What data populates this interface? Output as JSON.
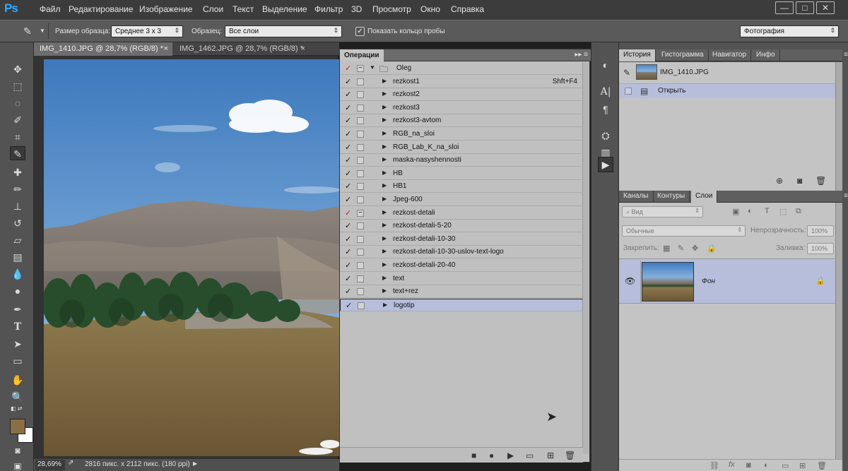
{
  "menubar": {
    "logo": "Ps",
    "items": [
      "Файл",
      "Редактирование",
      "Изображение",
      "Слои",
      "Текст",
      "Выделение",
      "Фильтр",
      "3D",
      "Просмотр",
      "Окно",
      "Справка"
    ],
    "window_buttons": [
      "—",
      "□",
      "✕"
    ]
  },
  "options": {
    "sample_size_label": "Размер образца:",
    "sample_size_value": "Среднее 3 х 3",
    "sample_label": "Образец:",
    "sample_value": "Все слои",
    "show_ring_label": "Показать кольцо пробы",
    "show_ring_checked": true,
    "workspace_value": "Фотография"
  },
  "tabs": [
    {
      "label": "IMG_1410.JPG @ 28,7% (RGB/8) *",
      "close": "×",
      "active": true
    },
    {
      "label": "IMG_1462.JPG @ 28,7% (RGB/8) *",
      "close": "×",
      "active": false
    }
  ],
  "status": {
    "zoom": "28,69%",
    "info": "2816 пикс. x 2112 пикс. (180 ppi)"
  },
  "actions": {
    "title": "Операции",
    "header_icons": "▸▸ ≡",
    "rows": [
      {
        "name": "Oleg",
        "check": "✓",
        "red": true,
        "box": "−",
        "set": true,
        "shortcut": "",
        "selected": false
      },
      {
        "name": "rezkost1",
        "check": "✓",
        "red": false,
        "box": "",
        "set": false,
        "shortcut": "Shft+F4",
        "selected": false
      },
      {
        "name": "rezkost2",
        "check": "✓",
        "red": false,
        "box": "",
        "set": false,
        "shortcut": "",
        "selected": false
      },
      {
        "name": "rezkost3",
        "check": "✓",
        "red": false,
        "box": "",
        "set": false,
        "shortcut": "",
        "selected": false
      },
      {
        "name": "rezkost3-avtom",
        "check": "✓",
        "red": false,
        "box": "",
        "set": false,
        "shortcut": "",
        "selected": false
      },
      {
        "name": "RGB_na_sloi",
        "check": "✓",
        "red": false,
        "box": "",
        "set": false,
        "shortcut": "",
        "selected": false
      },
      {
        "name": "RGB_Lab_K_na_sloi",
        "check": "✓",
        "red": false,
        "box": "",
        "set": false,
        "shortcut": "",
        "selected": false
      },
      {
        "name": "maska-nasyshennosti",
        "check": "✓",
        "red": false,
        "box": "",
        "set": false,
        "shortcut": "",
        "selected": false
      },
      {
        "name": "HB",
        "check": "✓",
        "red": false,
        "box": "",
        "set": false,
        "shortcut": "",
        "selected": false
      },
      {
        "name": "HB1",
        "check": "✓",
        "red": false,
        "box": "",
        "set": false,
        "shortcut": "",
        "selected": false
      },
      {
        "name": "Jpeg-600",
        "check": "✓",
        "red": false,
        "box": "",
        "set": false,
        "shortcut": "",
        "selected": false
      },
      {
        "name": "rezkost-detali",
        "check": "✓",
        "red": true,
        "box": "−",
        "set": false,
        "shortcut": "",
        "selected": false
      },
      {
        "name": "rezkost-detali-5-20",
        "check": "✓",
        "red": false,
        "box": "",
        "set": false,
        "shortcut": "",
        "selected": false
      },
      {
        "name": "rezkost-detali-10-30",
        "check": "✓",
        "red": false,
        "box": "",
        "set": false,
        "shortcut": "",
        "selected": false
      },
      {
        "name": "rezkost-detali-10-30-uslov-text-logo",
        "check": "✓",
        "red": false,
        "box": "",
        "set": false,
        "shortcut": "",
        "selected": false
      },
      {
        "name": "rezkost-detali-20-40",
        "check": "✓",
        "red": false,
        "box": "",
        "set": false,
        "shortcut": "",
        "selected": false
      },
      {
        "name": "text",
        "check": "✓",
        "red": false,
        "box": "",
        "set": false,
        "shortcut": "",
        "selected": false
      },
      {
        "name": "text+rez",
        "check": "✓",
        "red": false,
        "box": "",
        "set": false,
        "shortcut": "",
        "selected": false
      },
      {
        "name": "logotip",
        "check": "✓",
        "red": false,
        "box": "",
        "set": false,
        "shortcut": "",
        "selected": true
      }
    ],
    "footer_icons": [
      "■",
      "●",
      "▶",
      "▭",
      "⊞",
      "🗑"
    ]
  },
  "history": {
    "tabs": [
      "История",
      "Гистограмма",
      "Навигатор",
      "Инфо"
    ],
    "snapshot": "IMG_1410.JPG",
    "step": "Открыть"
  },
  "layers": {
    "tabs": [
      "Каналы",
      "Контуры",
      "Слои"
    ],
    "kind_placeholder": "Вид",
    "blend_mode": "Обычные",
    "opacity_label": "Непрозрачность:",
    "opacity_value": "100%",
    "lock_label": "Закрепить:",
    "fill_label": "Заливка:",
    "fill_value": "100%",
    "layer_name": "Фон"
  },
  "colors": {
    "foreground": "#8a6f45",
    "background": "#ffffff",
    "selection": "#b6bedc",
    "ps_blue": "#31a8ff"
  }
}
